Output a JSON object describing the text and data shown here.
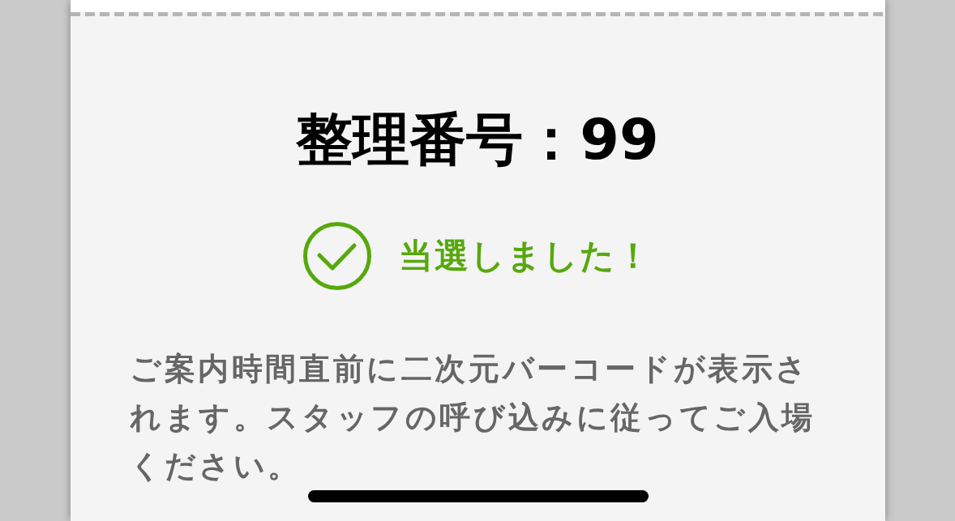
{
  "ticket": {
    "title": "整理番号：99",
    "status": {
      "kind": "won",
      "text": "当選しました！"
    },
    "message": "ご案内時間直前に二次元バーコードが表示されます。スタッフの呼び込みに従ってご入場ください。"
  }
}
